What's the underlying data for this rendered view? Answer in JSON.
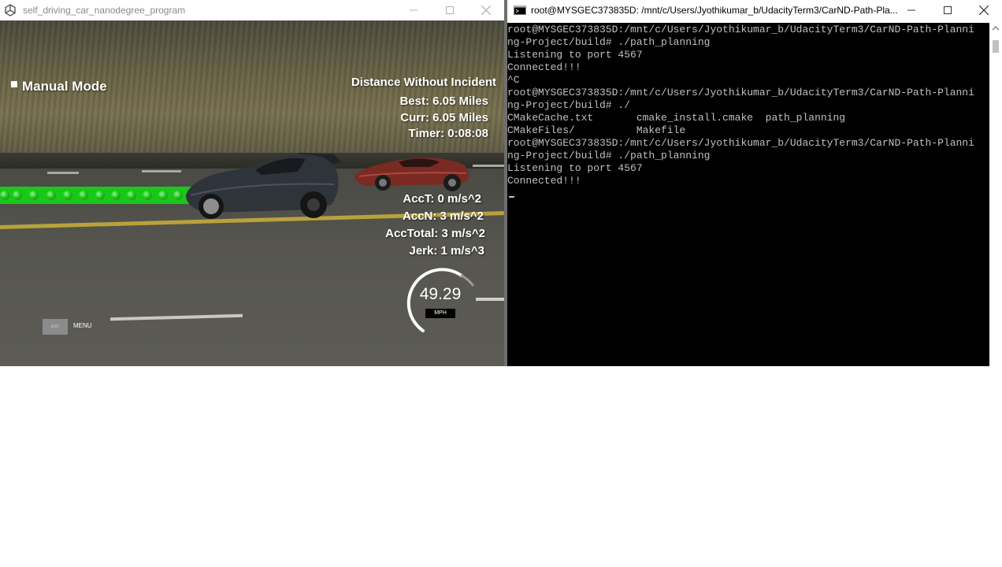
{
  "simulator": {
    "window_title": "self_driving_car_nanodegree_program",
    "mode_label": "Manual Mode",
    "distance_title": "Distance Without Incident",
    "best": "Best: 6.05 Miles",
    "curr": "Curr: 6.05 Miles",
    "timer": "Timer: 0:08:08",
    "acc_t": "AccT: 0 m/s^2",
    "acc_n": "AccN: 3 m/s^2",
    "acc_total": "AccTotal: 3 m/s^2",
    "jerk": "Jerk: 1 m/s^3",
    "speed_value": "49.29",
    "speed_unit": "MPH",
    "esc_label": "ESC",
    "menu_label": "MENU",
    "colors": {
      "path": "#19c819",
      "hud_text": "#ffffff"
    }
  },
  "console": {
    "window_title": "root@MYSGEC373835D: /mnt/c/Users/Jyothikumar_b/UdacityTerm3/CarND-Path-Pla...",
    "lines": [
      "root@MYSGEC373835D:/mnt/c/Users/Jyothikumar_b/UdacityTerm3/CarND-Path-Planni",
      "ng-Project/build# ./path_planning",
      "Listening to port 4567",
      "Connected!!!",
      "^C",
      "root@MYSGEC373835D:/mnt/c/Users/Jyothikumar_b/UdacityTerm3/CarND-Path-Planni",
      "ng-Project/build# ./",
      "CMakeCache.txt       cmake_install.cmake  path_planning",
      "CMakeFiles/          Makefile",
      "root@MYSGEC373835D:/mnt/c/Users/Jyothikumar_b/UdacityTerm3/CarND-Path-Planni",
      "ng-Project/build# ./path_planning",
      "Listening to port 4567",
      "Connected!!!"
    ],
    "colors": {
      "background": "#000000",
      "text": "#c0c0c0"
    }
  },
  "icons": {
    "simulator_app": "unity-icon",
    "console_app": "cmd-icon",
    "minimize": "minimize-icon",
    "maximize": "maximize-icon",
    "close": "close-icon"
  }
}
